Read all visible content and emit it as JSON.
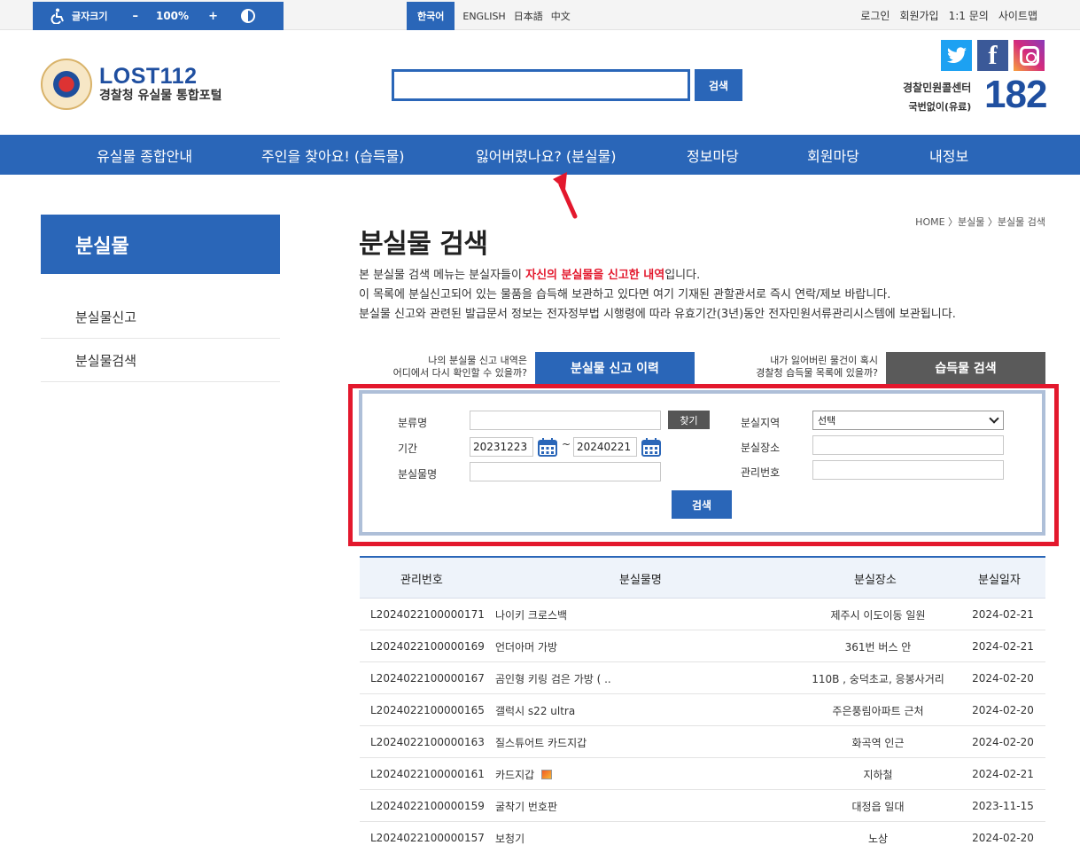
{
  "topbar": {
    "font_size_label": "글자크기",
    "minus": "–",
    "zoom": "100%",
    "plus": "+",
    "languages": [
      "한국어",
      "ENGLISH",
      "日本語",
      "中文"
    ],
    "util_links": [
      "로그인",
      "회원가입",
      "1:1 문의",
      "사이트맵"
    ]
  },
  "header": {
    "logo_en": "LOST112",
    "logo_ko": "경찰청 유실물 통합포털",
    "search_placeholder": "",
    "search_button": "검색",
    "call_center": "경찰민원콜센터",
    "call_note": "국번없이(유료)",
    "call_number": "182",
    "sns": [
      "twitter-icon",
      "facebook-icon",
      "instagram-icon"
    ],
    "facebook_glyph": "f"
  },
  "nav": {
    "items": [
      "유실물 종합안내",
      "주인을 찾아요! (습득물)",
      "잃어버렸나요? (분실물)",
      "정보마당",
      "회원마당",
      "내정보"
    ]
  },
  "sidebar": {
    "title": "분실물",
    "items": [
      "분실물신고",
      "분실물검색"
    ]
  },
  "main": {
    "breadcrumb": "HOME 〉분실물 〉분실물 검색",
    "title": "분실물 검색",
    "desc1_pre": "본 분실물 검색 메뉴는 분실자들이 ",
    "desc1_red": "자신의 분실물을 신고한 내역",
    "desc1_post": "입니다.",
    "desc2": "이 목록에 분실신고되어 있는 물품을 습득해 보관하고 있다면 여기 기재된 관할관서로 즉시 연락/제보 바랍니다.",
    "desc3": "분실물 신고와 관련된 발급문서 정보는 전자정부법 시행령에 따라 유효기간(3년)동안 전자민원서류관리시스템에 보관됩니다.",
    "q1_line1": "나의 분실물 신고 내역은",
    "q1_line2": "어디에서 다시 확인할 수 있을까?",
    "tab1": "분실물 신고 이력",
    "q2_line1": "내가 잃어버린 물건이 혹시",
    "q2_line2": "경찰청 습득물 목록에 있을까?",
    "tab2": "습득물 검색"
  },
  "form": {
    "category_label": "분류명",
    "category_value": "",
    "find_button": "찾기",
    "period_label": "기간",
    "date_from": "20231223",
    "tilde": "~",
    "date_to": "20240221",
    "item_label": "분실물명",
    "item_value": "",
    "region_label": "분실지역",
    "region_selected": "선택",
    "place_label": "분실장소",
    "place_value": "",
    "id_label": "관리번호",
    "id_value": "",
    "search_button": "검색"
  },
  "table": {
    "headers": [
      "관리번호",
      "분실물명",
      "분실장소",
      "분실일자"
    ],
    "rows": [
      {
        "id": "L2024022100000171",
        "name": "나이키 크로스백",
        "place": "제주시 이도이동 일원",
        "date": "2024-02-21",
        "thumb": false
      },
      {
        "id": "L2024022100000169",
        "name": "언더아머 가방",
        "place": "361번 버스 안",
        "date": "2024-02-21",
        "thumb": false
      },
      {
        "id": "L2024022100000167",
        "name": "곰인형 키링 검은 가방 ( ..",
        "place": "110B , 숭덕초교, 응봉사거리",
        "date": "2024-02-20",
        "thumb": false
      },
      {
        "id": "L2024022100000165",
        "name": "갤럭시 s22 ultra",
        "place": "주은풍림아파트 근처",
        "date": "2024-02-20",
        "thumb": false
      },
      {
        "id": "L2024022100000163",
        "name": "질스튜어트 카드지갑",
        "place": "화곡역 인근",
        "date": "2024-02-20",
        "thumb": false
      },
      {
        "id": "L2024022100000161",
        "name": "카드지갑",
        "place": "지하철",
        "date": "2024-02-21",
        "thumb": true
      },
      {
        "id": "L2024022100000159",
        "name": "굴착기 번호판",
        "place": "대정읍 일대",
        "date": "2023-11-15",
        "thumb": false
      },
      {
        "id": "L2024022100000157",
        "name": "보청기",
        "place": "노상",
        "date": "2024-02-20",
        "thumb": false
      }
    ]
  },
  "colors": {
    "primary": "#2a66b8",
    "highlight": "#e3182d",
    "gray_tab": "#5a5a5a"
  }
}
